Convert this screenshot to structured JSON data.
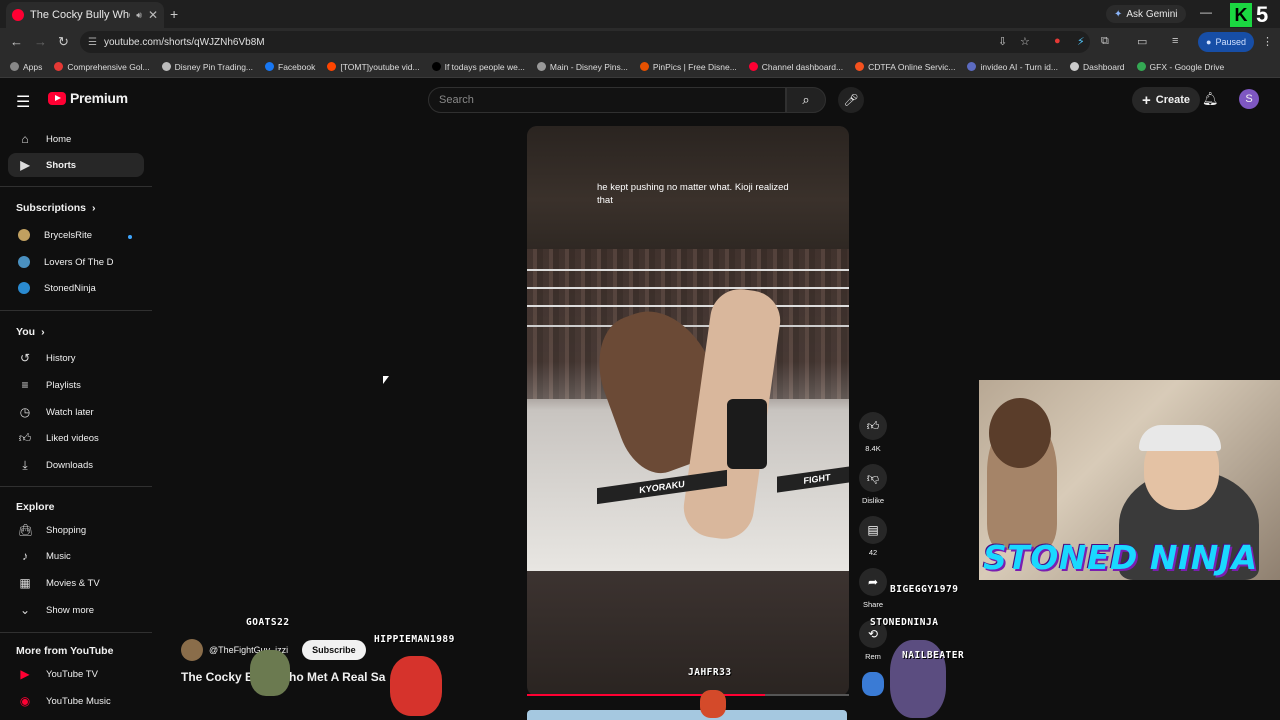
{
  "browser": {
    "tab_title": "The Cocky Bully Who Met A",
    "url": "youtube.com/shorts/qWJZNh6Vb8M",
    "ask_gemini": "Ask Gemini",
    "profile_status": "Paused",
    "bookmarks": [
      {
        "label": "Apps",
        "color": "#888888"
      },
      {
        "label": "Comprehensive Gol...",
        "color": "#e53935"
      },
      {
        "label": "Disney Pin Trading...",
        "color": "#bbbbbb"
      },
      {
        "label": "Facebook",
        "color": "#1877f2"
      },
      {
        "label": "[TOMT]youtube vid...",
        "color": "#ff4500"
      },
      {
        "label": "If todays people we...",
        "color": "#000000"
      },
      {
        "label": "Main - Disney Pins...",
        "color": "#999999"
      },
      {
        "label": "PinPics | Free Disne...",
        "color": "#e65100"
      },
      {
        "label": "Channel dashboard...",
        "color": "#ff0033"
      },
      {
        "label": "CDTFA Online Servic...",
        "color": "#f4511e"
      },
      {
        "label": "invideo AI - Turn id...",
        "color": "#5c6bc0"
      },
      {
        "label": "Dashboard",
        "color": "#cccccc"
      },
      {
        "label": "GFX - Google Drive",
        "color": "#34a853"
      }
    ]
  },
  "youtube": {
    "logo_text": "Premium",
    "search_placeholder": "Search",
    "create_label": "Create",
    "avatar_letter": "S"
  },
  "sidebar": {
    "main": [
      {
        "label": "Home",
        "icon": "home-icon"
      },
      {
        "label": "Shorts",
        "icon": "shorts-icon"
      }
    ],
    "subscriptions_title": "Subscriptions",
    "subscriptions": [
      {
        "label": "BrycelsRite",
        "color": "#c0a060"
      },
      {
        "label": "Lovers Of The D",
        "color": "#4a90c0"
      },
      {
        "label": "StonedNinja",
        "color": "#2a8ad0"
      }
    ],
    "you_title": "You",
    "you": [
      {
        "label": "History"
      },
      {
        "label": "Playlists"
      },
      {
        "label": "Watch later"
      },
      {
        "label": "Liked videos"
      },
      {
        "label": "Downloads"
      }
    ],
    "explore_title": "Explore",
    "explore": [
      {
        "label": "Shopping"
      },
      {
        "label": "Music"
      },
      {
        "label": "Movies & TV"
      },
      {
        "label": "Show more"
      }
    ],
    "more_title": "More from YouTube",
    "more": [
      {
        "label": "YouTube TV"
      },
      {
        "label": "YouTube Music"
      }
    ]
  },
  "short": {
    "caption": "he kept pushing no matter what. Kioji realized that",
    "floor_logo_1": "KYORAKU",
    "floor_logo_2": "FIGHT",
    "channel_handle": "@TheFightGuy_izzi",
    "subscribe_label": "Subscribe",
    "title": "The Cocky Bully Who Met A Real Sa",
    "progress": 0.74,
    "actions": {
      "likes": "8.4K",
      "dislike": "Dislike",
      "comments": "42",
      "share": "Share",
      "remix": "Rem"
    }
  },
  "stream_overlay": {
    "chatters": [
      "GOATS22",
      "HIPPIEMAN1989",
      "BIGEGGY1979",
      "STONEDNINJA",
      "NAILBEATER",
      "JAHFR33"
    ],
    "banner": "STONED NINJA",
    "k_logo": "K",
    "k_number": "5"
  }
}
